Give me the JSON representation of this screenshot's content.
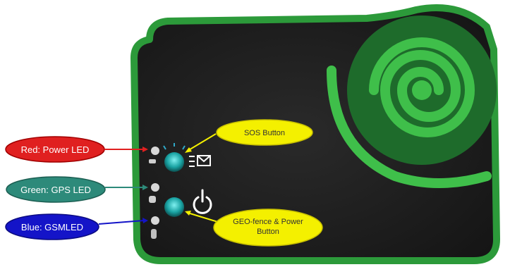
{
  "labels": {
    "red_led": "Red: Power LED",
    "green_led": "Green: GPS LED",
    "blue_led": "Blue: GSMLED"
  },
  "callouts": {
    "sos": "SOS Button",
    "geo_line1": "GEO-fence & Power",
    "geo_line2": "Button"
  },
  "colors": {
    "device_body": "#1f1f1f",
    "device_border": "#2c9a3a",
    "red_label": "#e02020",
    "green_label": "#2d8a7a",
    "blue_label": "#1414c8",
    "callout_fill": "#f4f000",
    "button_teal": "#1aa3a3"
  },
  "icons": {
    "sos": "envelope-signal-icon",
    "power": "power-icon"
  }
}
